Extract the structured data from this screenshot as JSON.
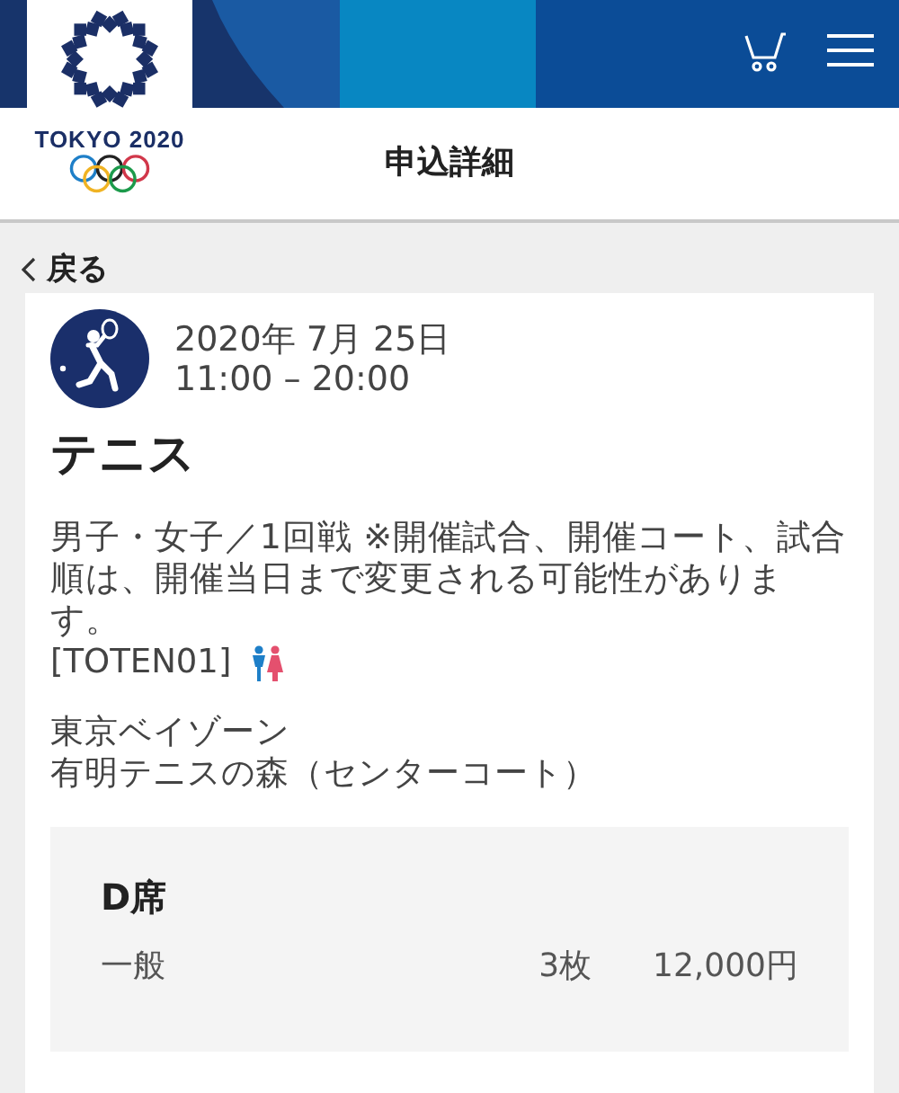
{
  "header": {
    "logo_text": "TOKYO 2020",
    "title": "申込詳細"
  },
  "back_label": "戻る",
  "event": {
    "date": "2020年 7月 25日",
    "time": "11:00 – 20:00",
    "sport": "テニス",
    "description": "男子・女子／1回戦 ※開催試合、開催コート、試合順は、開催当日まで変更される可能性があります。",
    "code": "[TOTEN01]",
    "venue": [
      "東京ベイゾーン",
      "有明テニスの森（センターコート）"
    ]
  },
  "seat": {
    "name": "D席",
    "type": "一般",
    "quantity": "3枚",
    "price": "12,000円"
  }
}
